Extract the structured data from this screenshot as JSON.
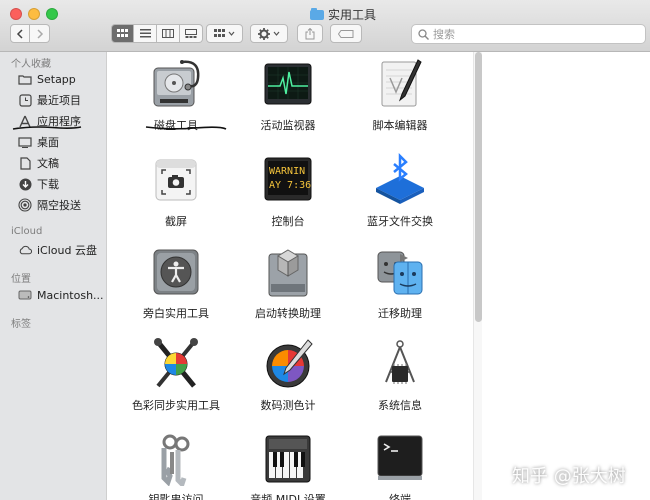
{
  "window": {
    "title": "实用工具"
  },
  "toolbar": {
    "search_placeholder": "搜索"
  },
  "sidebar": {
    "sections": [
      {
        "header": "个人收藏",
        "items": [
          {
            "label": "Setapp",
            "icon": "folder-icon"
          },
          {
            "label": "最近项目",
            "icon": "clock-icon"
          },
          {
            "label": "应用程序",
            "icon": "applications-icon"
          },
          {
            "label": "桌面",
            "icon": "desktop-icon"
          },
          {
            "label": "文稿",
            "icon": "document-icon"
          },
          {
            "label": "下载",
            "icon": "download-icon"
          },
          {
            "label": "隔空投送",
            "icon": "airdrop-icon"
          }
        ]
      },
      {
        "header": "iCloud",
        "items": [
          {
            "label": "iCloud 云盘",
            "icon": "cloud-icon"
          }
        ]
      },
      {
        "header": "位置",
        "items": [
          {
            "label": "Macintosh...",
            "icon": "disk-icon"
          }
        ]
      },
      {
        "header": "标签",
        "items": []
      }
    ]
  },
  "apps": [
    {
      "label": "磁盘工具",
      "icon": "disk-utility-icon"
    },
    {
      "label": "活动监视器",
      "icon": "activity-monitor-icon"
    },
    {
      "label": "脚本编辑器",
      "icon": "script-editor-icon"
    },
    {
      "label": "截屏",
      "icon": "screenshot-icon"
    },
    {
      "label": "控制台",
      "icon": "console-icon",
      "screen_text": [
        "WARNIN",
        "AY 7:36"
      ]
    },
    {
      "label": "蓝牙文件交换",
      "icon": "bluetooth-icon"
    },
    {
      "label": "旁白实用工具",
      "icon": "voiceover-icon"
    },
    {
      "label": "启动转换助理",
      "icon": "bootcamp-icon"
    },
    {
      "label": "迁移助理",
      "icon": "migration-icon"
    },
    {
      "label": "色彩同步实用工具",
      "icon": "colorsync-icon"
    },
    {
      "label": "数码测色计",
      "icon": "color-meter-icon"
    },
    {
      "label": "系统信息",
      "icon": "system-info-icon"
    },
    {
      "label": "钥匙串访问",
      "icon": "keychain-icon"
    },
    {
      "label": "音频 MIDI 设置",
      "icon": "audio-midi-icon"
    },
    {
      "label": "终端",
      "icon": "terminal-icon"
    }
  ],
  "watermark": "知乎 @张大树",
  "colors": {
    "sidebar_bg": "#e3e4e6",
    "toolbar_bg": "#dcdcdc",
    "accent_blue": "#1a73e8"
  }
}
